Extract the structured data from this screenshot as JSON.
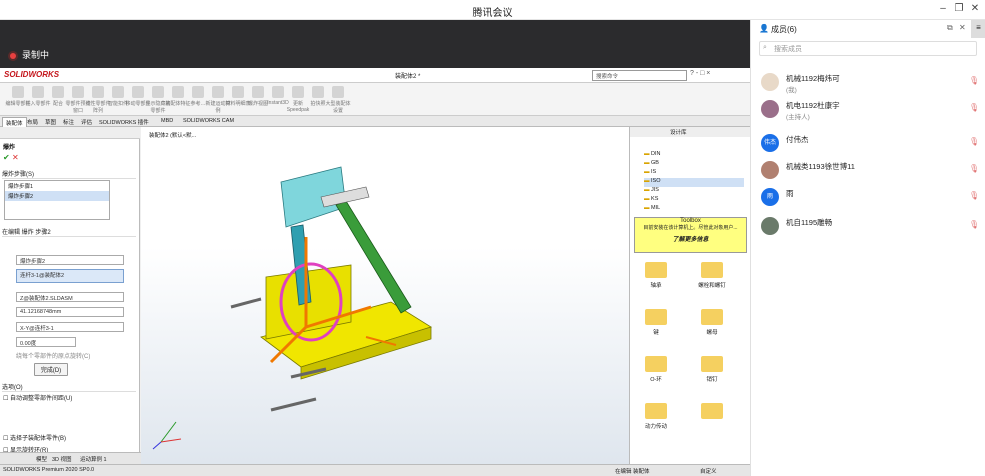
{
  "app": {
    "title": "腾讯会议",
    "recording": "录制中"
  },
  "sw": {
    "logo": "SOLIDWORKS",
    "doc_title": "装配体2 *",
    "search": "搜索命令",
    "ribbon": [
      "编辑零部件",
      "插入零部件",
      "配合",
      "零部件预览窗口",
      "线性零部件阵列",
      "智能扣件",
      "移动零部件",
      "显示隐藏的零部件",
      "装配体特征",
      "参考…",
      "新建运动算例",
      "材料明细表",
      "爆炸视图",
      "Instant3D",
      "更新Speedpak",
      "拍快照",
      "大型装配体设置"
    ],
    "tabs": [
      "装配体",
      "布局",
      "草图",
      "标注",
      "评估",
      "SOLIDWORKS 插件",
      "MBD",
      "SOLIDWORKS CAM"
    ],
    "tree_title": "装配体2 (默认<默...",
    "left": {
      "title": "爆炸",
      "steps_label": "爆炸步骤(S)",
      "steps": [
        "爆炸步骤1",
        "爆炸步骤2"
      ],
      "edit_label": "在编辑 爆炸 步骤2",
      "step_name": "爆炸步骤2",
      "component": "连杆3-1@装配体2",
      "distance_label": "Z@装配体2.SLDASM",
      "distance": "41.12168748mm",
      "axis": "X-Y@连杆3-1",
      "angle": "0.00度",
      "rotate_opt": "绕每个零部件的原点旋转(C)",
      "done": "完成(D)",
      "options": "选项(O)",
      "auto_space": "自动调整零部件间距(U)",
      "sub_explode": "选择子装配体零件(B)",
      "sub_parts": "显示旋转环(R)"
    },
    "lib": {
      "title": "设计库",
      "tree": [
        "DIN",
        "GB",
        "IS",
        "ISO",
        "JIS",
        "KS",
        "MIL"
      ],
      "toolbox_title": "Toolbox",
      "toolbox_msg": "目前安装在该计算机上。尽管此对象用户...",
      "more": "了解更多信息",
      "items": [
        "轴承",
        "螺栓和螺钉",
        "键",
        "螺母",
        "O-环",
        "销钉",
        "动力传动",
        ""
      ]
    },
    "bottom_tabs": [
      "模型",
      "3D 视图",
      "运动算例 1"
    ],
    "status": [
      "SOLIDWORKS Premium 2020 SP0.0",
      "在编辑 装配体",
      "自定义"
    ]
  },
  "members": {
    "header": "成员(6)",
    "search_placeholder": "搜索成员",
    "list": [
      {
        "name": "机械1192梅炜可",
        "role": "(我)",
        "color": "#e8d9c8",
        "initial": ""
      },
      {
        "name": "机电1192杜康宇",
        "role": "(主持人)",
        "color": "#9a6f8a",
        "initial": ""
      },
      {
        "name": "付伟杰",
        "role": "",
        "color": "#1a6fe8",
        "initial": "伟杰"
      },
      {
        "name": "机械类1193徐世博11",
        "role": "",
        "color": "#b08070",
        "initial": ""
      },
      {
        "name": "雨",
        "role": "",
        "color": "#1a6fe8",
        "initial": "雨"
      },
      {
        "name": "机自1195雕畅",
        "role": "",
        "color": "#6a7a6a",
        "initial": ""
      }
    ]
  }
}
